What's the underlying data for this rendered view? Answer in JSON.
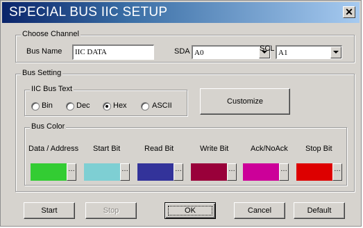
{
  "window": {
    "title": "SPECIAL BUS IIC SETUP",
    "close_symbol": "✕"
  },
  "choose_channel": {
    "label": "Choose Channel",
    "bus_name_label": "Bus Name",
    "bus_name_value": "IIC DATA",
    "sda_label": "SDA",
    "sda_value": "A0",
    "scl_label": "SCL",
    "scl_value": "A1"
  },
  "bus_setting": {
    "label": "Bus Setting",
    "iic_bus_text": {
      "label": "IIC Bus Text",
      "options": [
        {
          "label": "Bin",
          "checked": false
        },
        {
          "label": "Dec",
          "checked": false
        },
        {
          "label": "Hex",
          "checked": true
        },
        {
          "label": "ASCII",
          "checked": false
        }
      ]
    },
    "customize_label": "Customize",
    "bus_color": {
      "label": "Bus Color",
      "items": [
        {
          "label": "Data / Address",
          "color": "#33cc33"
        },
        {
          "label": "Start Bit",
          "color": "#7ecfd3"
        },
        {
          "label": "Read Bit",
          "color": "#33339a"
        },
        {
          "label": "Write Bit",
          "color": "#99003a"
        },
        {
          "label": "Ack/NoAck",
          "color": "#cc0099"
        },
        {
          "label": "Stop Bit",
          "color": "#dd0000"
        }
      ],
      "picker_symbol": "…"
    }
  },
  "buttons": {
    "start": "Start",
    "stop": "Stop",
    "ok": "OK",
    "cancel": "Cancel",
    "default": "Default"
  }
}
